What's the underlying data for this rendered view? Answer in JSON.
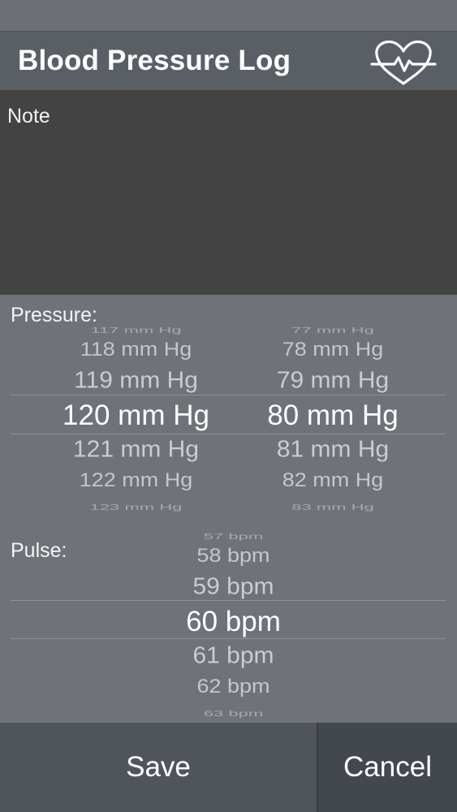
{
  "header": {
    "title": "Blood Pressure Log",
    "icon": "heart-pulse-icon"
  },
  "note": {
    "label": "Note",
    "value": ""
  },
  "pressure": {
    "label": "Pressure:",
    "systolic": [
      "117 mm Hg",
      "118 mm Hg",
      "119 mm Hg",
      "120 mm Hg",
      "121 mm Hg",
      "122 mm Hg",
      "123 mm Hg"
    ],
    "diastolic": [
      "77 mm Hg",
      "78 mm Hg",
      "79 mm Hg",
      "80 mm Hg",
      "81 mm Hg",
      "82 mm Hg",
      "83 mm Hg"
    ],
    "selected_systolic": "120 mm Hg",
    "selected_diastolic": "80 mm Hg"
  },
  "pulse": {
    "label": "Pulse:",
    "values": [
      "57 bpm",
      "58 bpm",
      "59 bpm",
      "60 bpm",
      "61 bpm",
      "62 bpm",
      "63 bpm"
    ],
    "selected": "60 bpm"
  },
  "footer": {
    "save_label": "Save",
    "cancel_label": "Cancel"
  },
  "colors": {
    "header": "#5a5f66",
    "note_bg": "#434343",
    "picker_bg": "#6f7279",
    "cancel_bg": "#43474e"
  }
}
